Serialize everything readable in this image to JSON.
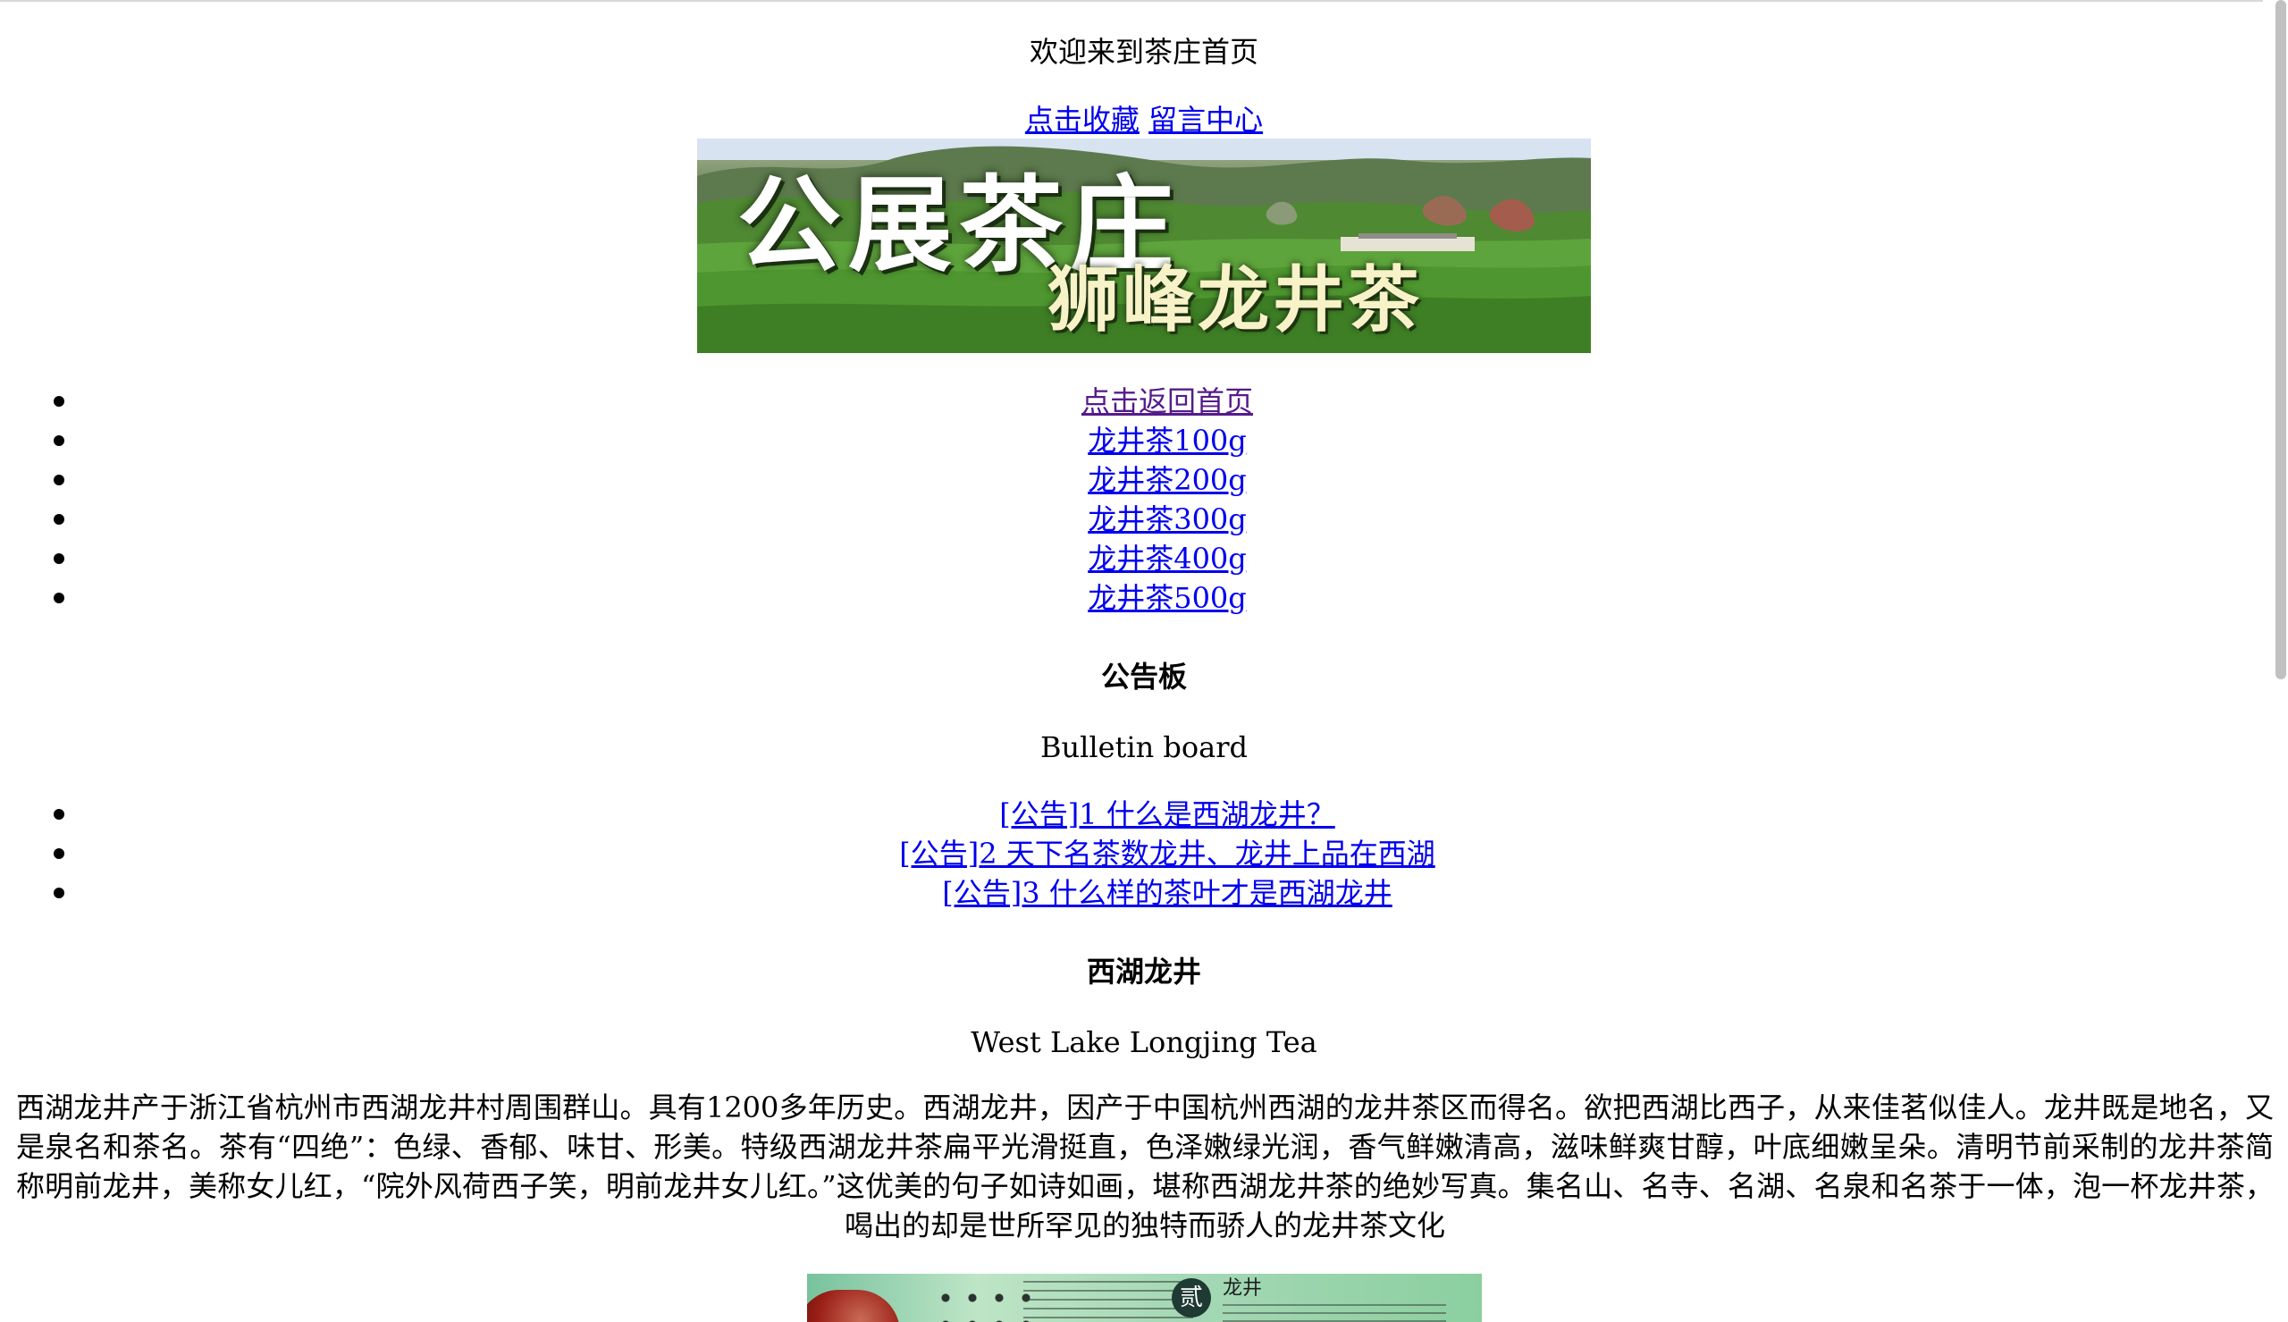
{
  "header": {
    "welcome": "欢迎来到茶庄首页",
    "favorite_link": "点击收藏",
    "message_link": "留言中心"
  },
  "banner": {
    "title": "公展茶庄",
    "subtitle": "狮峰龙井茶"
  },
  "nav": {
    "items": [
      {
        "label": "点击返回首页",
        "visited": true
      },
      {
        "label": "龙井茶100g",
        "visited": false
      },
      {
        "label": "龙井茶200g",
        "visited": false
      },
      {
        "label": "龙井茶300g",
        "visited": false
      },
      {
        "label": "龙井茶400g",
        "visited": false
      },
      {
        "label": "龙井茶500g",
        "visited": false
      }
    ]
  },
  "bulletin": {
    "title": "公告板",
    "subtitle": "Bulletin board",
    "items": [
      {
        "label": "[公告]1 什么是西湖龙井？"
      },
      {
        "label": "[公告]2 天下名茶数龙井、龙井上品在西湖"
      },
      {
        "label": "[公告]3 什么样的茶叶才是西湖龙井"
      }
    ]
  },
  "tea_section": {
    "title": "西湖龙井",
    "subtitle": "West Lake Longjing Tea",
    "description": "西湖龙井产于浙江省杭州市西湖龙井村周围群山。具有1200多年历史。西湖龙井，因产于中国杭州西湖的龙井茶区而得名。欲把西湖比西子，从来佳茗似佳人。龙井既是地名，又是泉名和茶名。茶有“四绝”：色绿、香郁、味甘、形美。特级西湖龙井茶扁平光滑挺直，色泽嫩绿光润，香气鲜嫩清高，滋味鲜爽甘醇，叶底细嫩呈朵。清明节前采制的龙井茶简称明前龙井，美称女儿红，“院外风荷西子笑，明前龙井女儿红。”这优美的句子如诗如画，堪称西湖龙井茶的绝妙写真。集名山、名寺、名湖、名泉和名茶于一体，泡一杯龙井茶，喝出的却是世所罕见的独特而骄人的龙井茶文化"
  },
  "bottom_image": {
    "badge": "贰",
    "label": "龙井"
  },
  "colors": {
    "link": "#0000ee",
    "visited_link": "#551a8b",
    "text": "#000000",
    "background": "#ffffff"
  },
  "icons": {
    "list_bullet": "bullet-dot-icon",
    "scroll_thumb": "scrollbar-thumb"
  }
}
